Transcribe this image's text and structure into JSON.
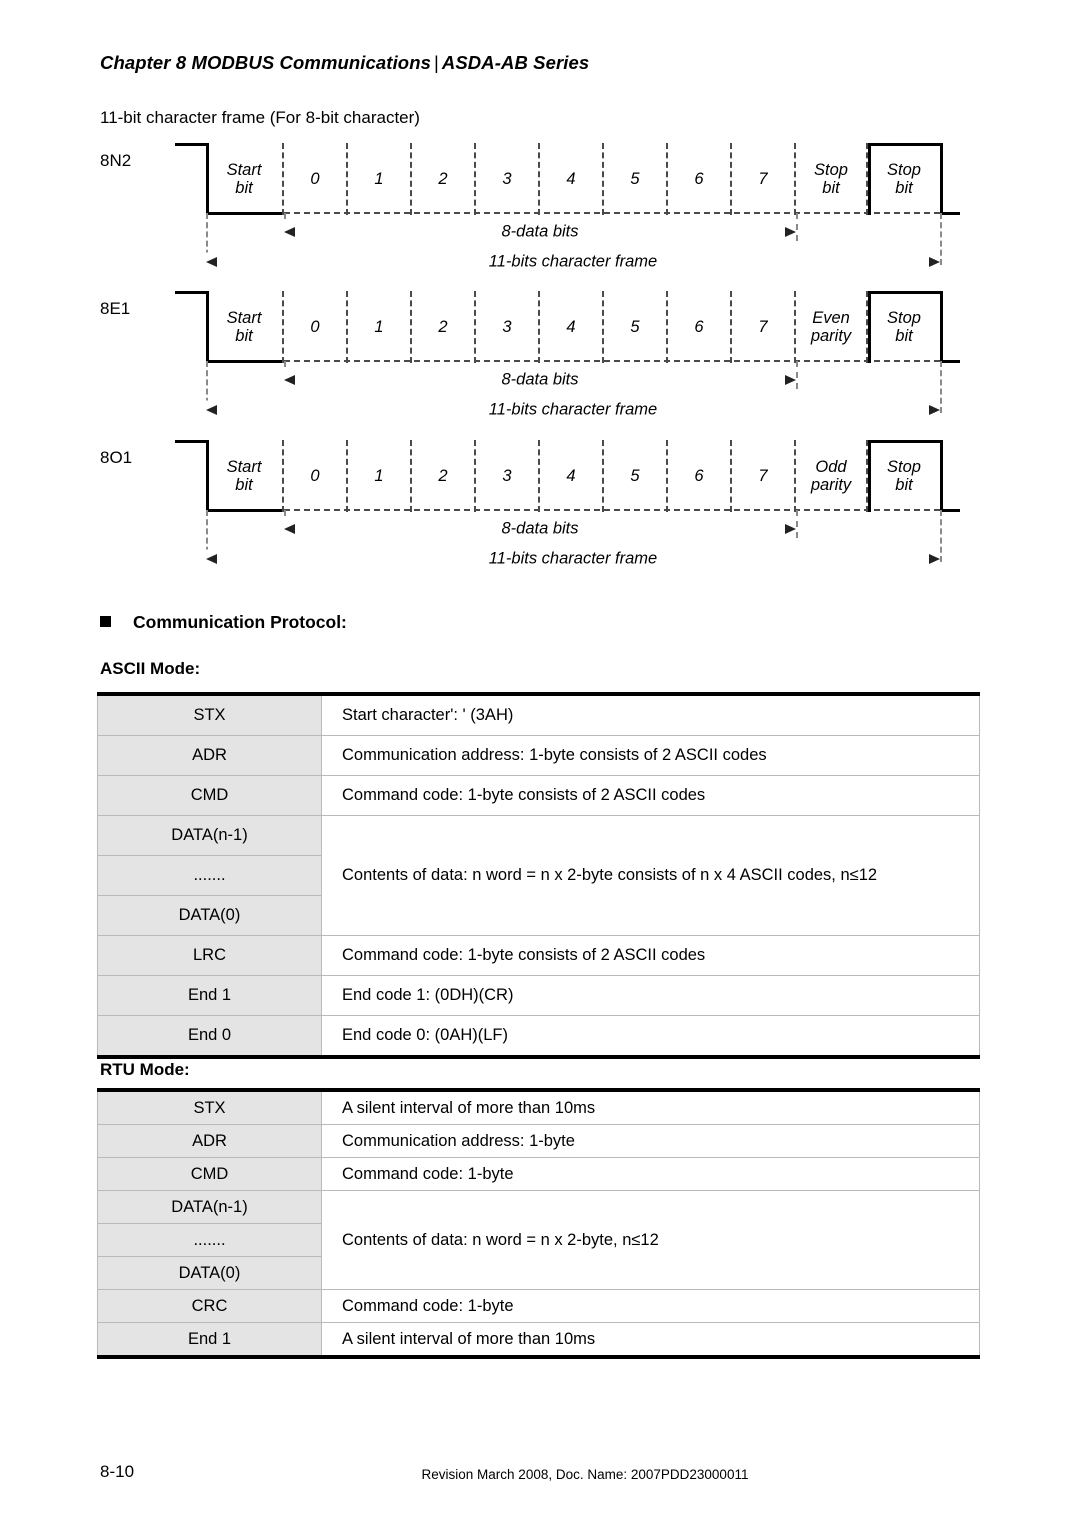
{
  "header": {
    "chapter": "Chapter 8  MODBUS Communications",
    "separator": "|",
    "series": "ASDA-AB Series"
  },
  "intro": {
    "line": "11-bit character frame (For 8-bit character)"
  },
  "diagrams": [
    {
      "id": "8N2",
      "label": "8N2",
      "cells": [
        "Start bit",
        "0",
        "1",
        "2",
        "3",
        "4",
        "5",
        "6",
        "7",
        "Stop bit",
        "Stop bit"
      ],
      "start_label_line1": "Start",
      "start_label_line2": "bit",
      "tail_cells": [
        {
          "line1": "Stop",
          "line2": "bit"
        },
        {
          "line1": "Stop",
          "line2": "bit"
        }
      ],
      "dim_data": "8-data bits",
      "dim_frame": "11-bits character frame"
    },
    {
      "id": "8E1",
      "label": "8E1",
      "cells": [
        "Start bit",
        "0",
        "1",
        "2",
        "3",
        "4",
        "5",
        "6",
        "7",
        "Even parity",
        "Stop bit"
      ],
      "start_label_line1": "Start",
      "start_label_line2": "bit",
      "tail_cells": [
        {
          "line1": "Even",
          "line2": "parity"
        },
        {
          "line1": "Stop",
          "line2": "bit"
        }
      ],
      "dim_data": "8-data bits",
      "dim_frame": "11-bits character frame"
    },
    {
      "id": "8O1",
      "label": "8O1",
      "cells": [
        "Start bit",
        "0",
        "1",
        "2",
        "3",
        "4",
        "5",
        "6",
        "7",
        "Odd parity",
        "Stop bit"
      ],
      "start_label_line1": "Start",
      "start_label_line2": "bit",
      "tail_cells": [
        {
          "line1": "Odd",
          "line2": "parity"
        },
        {
          "line1": "Stop",
          "line2": "bit"
        }
      ],
      "dim_data": "8-data bits",
      "dim_frame": "11-bits character frame"
    }
  ],
  "data_bits": [
    "0",
    "1",
    "2",
    "3",
    "4",
    "5",
    "6",
    "7"
  ],
  "protocol": {
    "heading": "Communication Protocol:",
    "ascii_heading": "ASCII Mode:",
    "rtu_heading": "RTU Mode:"
  },
  "ascii_table": {
    "rows": [
      {
        "key": "STX",
        "value": "Start character': ' (3AH)"
      },
      {
        "key": "ADR",
        "value": "Communication address: 1-byte consists of 2 ASCII codes"
      },
      {
        "key": "CMD",
        "value": "Command code: 1-byte consists of 2 ASCII codes"
      },
      {
        "key": "DATA(n-1)",
        "value": ""
      },
      {
        "key": ".......",
        "value": "Contents of data: n word = n x 2-byte consists of n x 4 ASCII codes, n≤12"
      },
      {
        "key": "DATA(0)",
        "value": ""
      },
      {
        "key": "LRC",
        "value": "Command code: 1-byte consists of 2 ASCII codes"
      },
      {
        "key": "End 1",
        "value": "End code 1: (0DH)(CR)"
      },
      {
        "key": "End 0",
        "value": "End code 0: (0AH)(LF)"
      }
    ],
    "merged_value": "Contents of data: n word = n x 2-byte consists of n x 4 ASCII codes, n≤12"
  },
  "rtu_table": {
    "rows": [
      {
        "key": "STX",
        "value": "A silent interval of more than 10ms"
      },
      {
        "key": "ADR",
        "value": "Communication address: 1-byte"
      },
      {
        "key": "CMD",
        "value": "Command code: 1-byte"
      },
      {
        "key": "DATA(n-1)",
        "value": ""
      },
      {
        "key": ".......",
        "value": "Contents of data: n word = n x 2-byte, n≤12"
      },
      {
        "key": "DATA(0)",
        "value": ""
      },
      {
        "key": "CRC",
        "value": "Command code: 1-byte"
      },
      {
        "key": "End 1",
        "value": "A silent interval of more than 10ms"
      }
    ],
    "merged_value": "Contents of data: n word = n x 2-byte, n≤12"
  },
  "footer": {
    "page_number": "8-10",
    "revision": "Revision March 2008, Doc. Name: 2007PDD23000011"
  }
}
